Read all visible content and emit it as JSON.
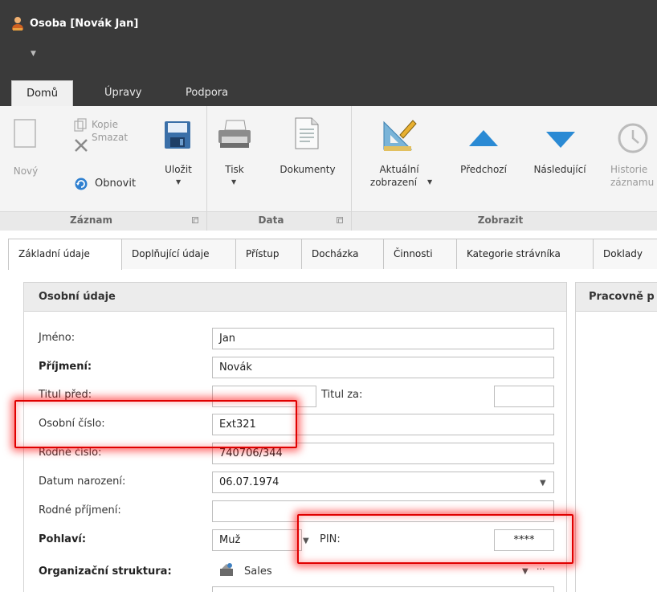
{
  "window": {
    "title": "Osoba [Novák Jan]"
  },
  "ribbon_tabs": [
    "Domů",
    "Úpravy",
    "Podpora"
  ],
  "groups": {
    "zaznam": {
      "label": "Záznam",
      "novy": "Nový",
      "kopie": "Kopie",
      "smazat": "Smazat",
      "obnovit": "Obnovit",
      "ulozit": "Uložit"
    },
    "data": {
      "label": "Data",
      "tisk": "Tisk",
      "dokumenty": "Dokumenty"
    },
    "zobrazit": {
      "label": "Zobrazit",
      "aktualni_1": "Aktuální",
      "aktualni_2": "zobrazení",
      "predchozi": "Předchozí",
      "nasledujici": "Následující",
      "historie_1": "Historie",
      "historie_2": "záznamu"
    }
  },
  "page_tabs": [
    "Základní údaje",
    "Doplňující údaje",
    "Přístup",
    "Docházka",
    "Činnosti",
    "Kategorie strávníka",
    "Doklady"
  ],
  "panel": {
    "title": "Osobní údaje",
    "side_title": "Pracovně p"
  },
  "form": {
    "jmeno_label": "Jméno:",
    "jmeno_value": "Jan",
    "prijmeni_label": "Příjmení:",
    "prijmeni_value": "Novák",
    "titul_pred_label": "Titul před:",
    "titul_pred_value": "",
    "titul_za_label": "Titul za:",
    "titul_za_value": "",
    "osobni_cislo_label": "Osobní číslo:",
    "osobni_cislo_value": "Ext321",
    "rodne_cislo_label": "Rodné číslo:",
    "rodne_cislo_value": "740706/344",
    "datum_label": "Datum narození:",
    "datum_value": "06.07.1974",
    "rodne_prijmeni_label": "Rodné příjmení:",
    "rodne_prijmeni_value": "",
    "pohlavi_label": "Pohlaví:",
    "pohlavi_value": "Muž",
    "pin_label": "PIN:",
    "pin_value": "****",
    "org_label": "Organizační struktura:",
    "org_value": "Sales",
    "org_more": "···"
  },
  "colors": {
    "titlebar": "#3a3a3a",
    "ribbon": "#f4f4f4",
    "highlight": "#e00000",
    "arrow_up": "#2a8ad4",
    "arrow_down": "#2a8ad4"
  }
}
